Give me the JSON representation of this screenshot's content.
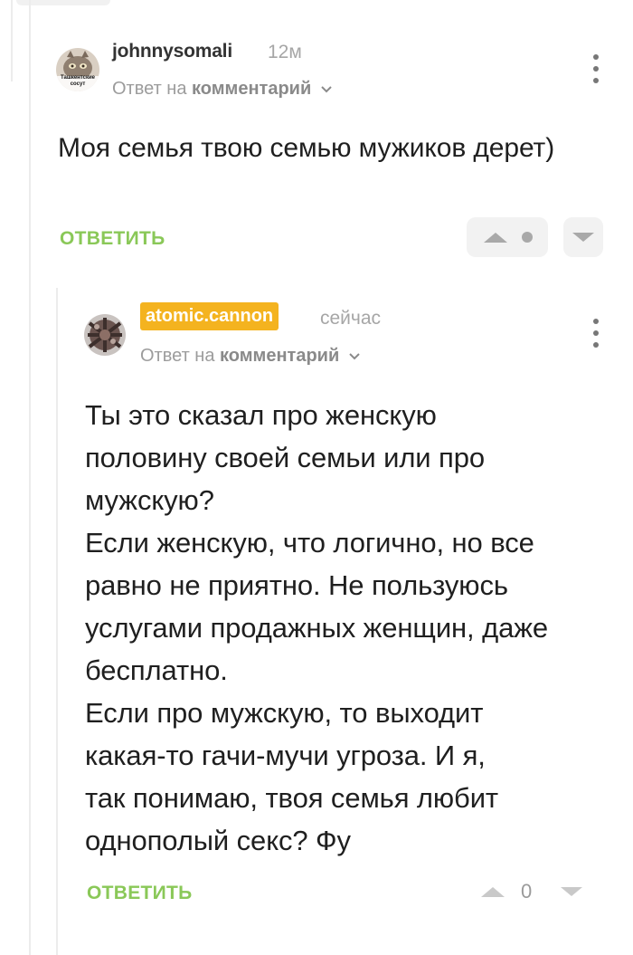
{
  "comments": [
    {
      "username": "johnnysomali",
      "time": "12м",
      "reply_prefix": "Ответ на",
      "reply_target": "комментарий",
      "avatar_caption": "Ташкентские сосут",
      "text": "Моя семья твою семью мужиков дерет)",
      "reply_label": "ОТВЕТИТЬ",
      "rating_display": "dot"
    },
    {
      "username": "atomic.cannon",
      "time": "сейчас",
      "reply_prefix": "Ответ на",
      "reply_target": "комментарий",
      "text_lines": [
        "Ты это сказал про женскую",
        "половину своей семьи или про",
        "мужскую?",
        "Если женскую, что логично, но все",
        "равно не приятно. Не пользуюсь",
        "услугами продажных женщин, даже",
        "бесплатно.",
        "Если про мужскую, то выходит",
        "какая-то гачи-мучи угроза. И я,",
        "так понимаю, твоя семья любит",
        "однополый секс? Фу"
      ],
      "reply_label": "ОТВЕТИТЬ",
      "score": "0"
    }
  ],
  "colors": {
    "reply_green": "#8ac858",
    "badge_yellow": "#f4b31f",
    "meta_gray": "#9c9c9c"
  },
  "icons": [
    "kebab-menu-icon",
    "chevron-down-icon",
    "upvote-icon",
    "downvote-icon",
    "rating-dot-icon"
  ]
}
